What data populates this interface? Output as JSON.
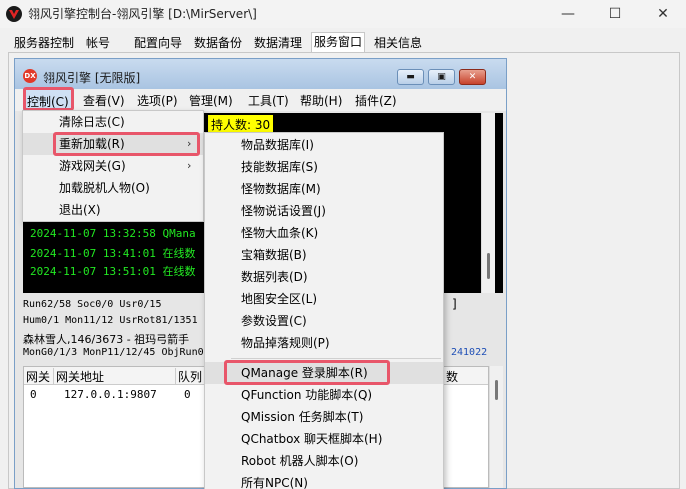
{
  "window": {
    "title": "翎风引擎控制台-翎风引擎 [D:\\MirServer\\]",
    "minimize_glyph": "—",
    "maximize_glyph": "☐",
    "close_glyph": "✕"
  },
  "tabs": [
    {
      "label": "服务器控制"
    },
    {
      "label": "帐号"
    },
    {
      "label": "配置向导"
    },
    {
      "label": "数据备份"
    },
    {
      "label": "数据清理"
    },
    {
      "label": "服务窗口",
      "active": true
    },
    {
      "label": "相关信息"
    }
  ],
  "inner_window": {
    "logo_text": "DX",
    "title": "翎风引擎 [无限版]",
    "btn_minimize": "▬",
    "btn_restore": "▣",
    "btn_close": "✕"
  },
  "menubar": [
    {
      "label": "控制(C)"
    },
    {
      "label": "查看(V)"
    },
    {
      "label": "选项(P)"
    },
    {
      "label": "管理(M)"
    },
    {
      "label": "工具(T)"
    },
    {
      "label": "帮助(H)"
    },
    {
      "label": "插件(Z)"
    }
  ],
  "control_menu": [
    {
      "label": "清除日志(C)"
    },
    {
      "label": "重新加载(R)",
      "submenu": true,
      "highlighted": true
    },
    {
      "label": "游戏网关(G)",
      "submenu": true
    },
    {
      "label": "加载脱机人物(O)"
    },
    {
      "label": "退出(X)"
    }
  ],
  "submenu_arrow": "›",
  "reload_submenu": [
    {
      "label": "物品数据库(I)"
    },
    {
      "label": "技能数据库(S)"
    },
    {
      "label": "怪物数据库(M)"
    },
    {
      "label": "怪物说话设置(J)"
    },
    {
      "label": "怪物大血条(K)"
    },
    {
      "label": "宝箱数据(B)"
    },
    {
      "label": "数据列表(D)"
    },
    {
      "label": "地图安全区(L)"
    },
    {
      "label": "参数设置(C)"
    },
    {
      "label": "物品掉落规则(P)"
    },
    {
      "label": "QManage 登录脚本(R)",
      "highlighted": true
    },
    {
      "label": "QFunction 功能脚本(Q)"
    },
    {
      "label": "QMission 任务脚本(T)"
    },
    {
      "label": "QChatbox 聊天框脚本(H)"
    },
    {
      "label": "Robot 机器人脚本(O)"
    },
    {
      "label": "所有NPC(N)"
    }
  ],
  "console": {
    "online_label": "持人数: 30",
    "log_lines": [
      "2024-11-07 13:32:58 QMana",
      "2024-11-07 13:41:01 在线数",
      "2024-11-07 13:51:01 在线数"
    ]
  },
  "status": {
    "line1": "Run62/58 Soc0/0 Usr0/15",
    "line2": "Hum0/1 Mon11/12 UsrRot81/1351 I",
    "line3": "森林雪人,146/3673 - 祖玛弓箭手",
    "line4": "MonG0/1/3 MonP11/12/45 ObjRun0",
    "bracket": "]",
    "version": "241022"
  },
  "gate_table": {
    "columns": [
      "网关",
      "网关地址",
      "队列",
      "数"
    ],
    "rows": [
      [
        "0",
        "127.0.0.1:9807",
        "0"
      ]
    ]
  },
  "colors": {
    "highlight_box": "#e8566a",
    "console_bg": "#000000",
    "log_text": "#22e822",
    "online_bg": "#ffff00",
    "version_text": "#1f4fb6"
  }
}
